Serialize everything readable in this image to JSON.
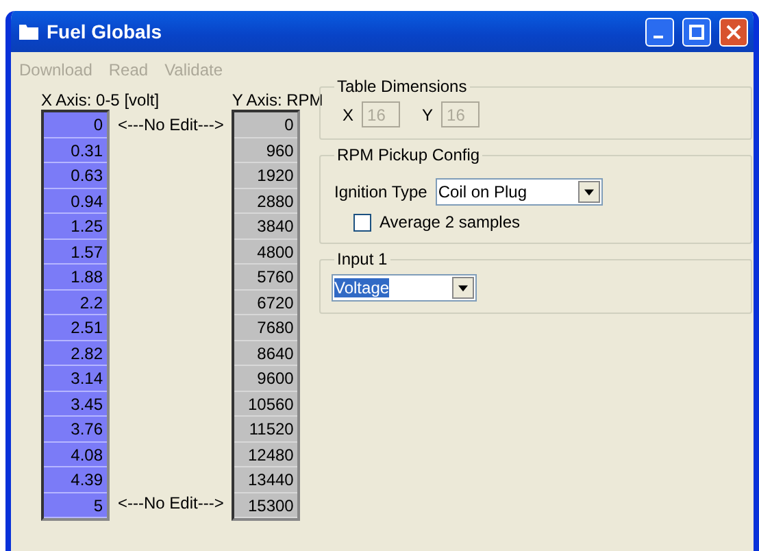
{
  "window": {
    "title": "Fuel Globals"
  },
  "menu": [
    {
      "label": "Download",
      "disabled": true
    },
    {
      "label": "Read",
      "disabled": true
    },
    {
      "label": "Validate",
      "disabled": true
    }
  ],
  "x_axis": {
    "label": "X Axis: 0-5 [volt]",
    "values": [
      "0",
      "0.31",
      "0.63",
      "0.94",
      "1.25",
      "1.57",
      "1.88",
      "2.2",
      "2.51",
      "2.82",
      "3.14",
      "3.45",
      "3.76",
      "4.08",
      "4.39",
      "5"
    ]
  },
  "y_axis": {
    "label": "Y Axis: RPM",
    "values": [
      "0",
      "960",
      "1920",
      "2880",
      "3840",
      "4800",
      "5760",
      "6720",
      "7680",
      "8640",
      "9600",
      "10560",
      "11520",
      "12480",
      "13440",
      "15300"
    ]
  },
  "no_edit_labels": [
    "<---No Edit--->",
    "<---No Edit--->"
  ],
  "table_dimensions": {
    "title": "Table Dimensions",
    "fields": [
      {
        "label": "X",
        "value": "16",
        "disabled": true
      },
      {
        "label": "Y",
        "value": "16",
        "disabled": true
      }
    ]
  },
  "rpm_pickup_config": {
    "title": "RPM Pickup Config",
    "ignition_type": {
      "label": "Ignition Type",
      "value": "Coil on Plug"
    },
    "average": {
      "label": "Average 2 samples",
      "checked": false
    }
  },
  "input_1": {
    "title": "Input 1",
    "value": "Voltage",
    "highlighted": true
  }
}
